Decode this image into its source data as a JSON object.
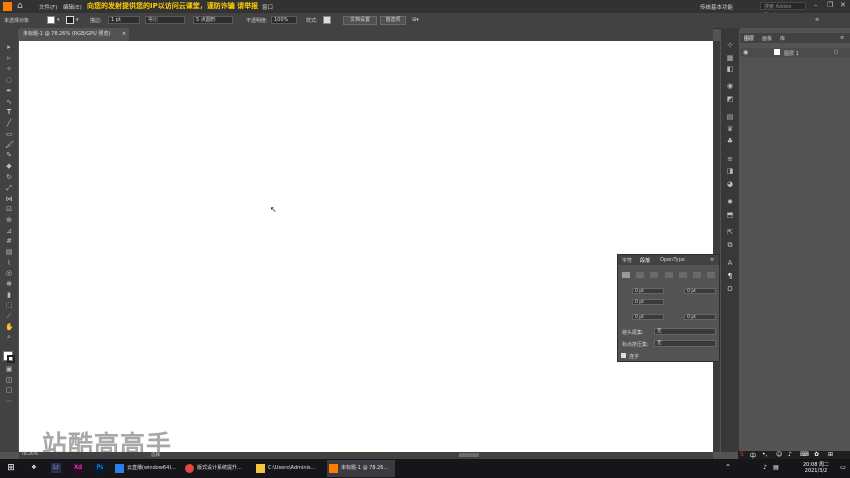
{
  "menubar": {
    "menus": [
      "文件(F)",
      "编辑(E)"
    ],
    "banner": "向您的发射提供您的IP以访问云课堂，谨防诈骗 请举报",
    "workspace": "传统基本功能",
    "search_placeholder": "搜索 Adobe Stock",
    "tail_menu": "窗口"
  },
  "control": {
    "selection_label": "未选择对象",
    "stroke_label": "描边:",
    "stroke_value": "1 pt",
    "stroke_style": "等比",
    "brush_label": "5 点圆形",
    "opacity_label": "不透明度:",
    "opacity_value": "100%",
    "style_label": "样式:",
    "doc_setup": "文档设置",
    "prefs": "首选项"
  },
  "document": {
    "tab_title": "未标题-1 @ 78.26% (RGB/GPU 预览)",
    "zoom": "78.26%",
    "status": "选择"
  },
  "watermark": "站酷高高手",
  "layers": {
    "tabs": [
      "图层",
      "画板",
      "库"
    ],
    "layer_name": "图层 1"
  },
  "char_panel": {
    "tabs": [
      "字符",
      "段落",
      "OpenType"
    ],
    "fields": [
      "0 pt",
      "0 pt",
      "0 pt",
      "0 pt",
      "0 pt"
    ],
    "avoid_head_label": "避头尾集:",
    "avoid_head_value": "无",
    "punct_label": "标点挤压集:",
    "punct_value": "无",
    "hyphen_label": "连字"
  },
  "taskbar": {
    "apps": [
      "云直播(window64)...",
      "版式设计系统提升...",
      "C:\\Users\\Adminis...",
      "未标题-1 @ 78.26..."
    ],
    "time": "20:08 周二",
    "date": "2021/3/2"
  },
  "ime": {
    "label": "中"
  }
}
